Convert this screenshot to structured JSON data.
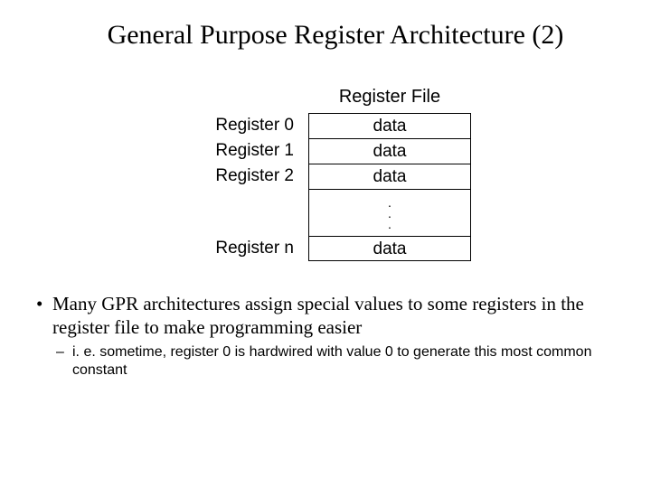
{
  "title": "General Purpose Register Architecture (2)",
  "diagram": {
    "heading": "Register File",
    "rows": [
      {
        "label": "Register 0",
        "value": "data"
      },
      {
        "label": "Register 1",
        "value": "data"
      },
      {
        "label": "Register 2",
        "value": "data"
      }
    ],
    "last": {
      "label": "Register n",
      "value": "data"
    }
  },
  "bullets": {
    "main": "Many GPR architectures assign special values to some registers in the register file to make programming easier",
    "sub": "i. e. sometime, register 0 is hardwired with value 0 to generate this most common constant"
  }
}
